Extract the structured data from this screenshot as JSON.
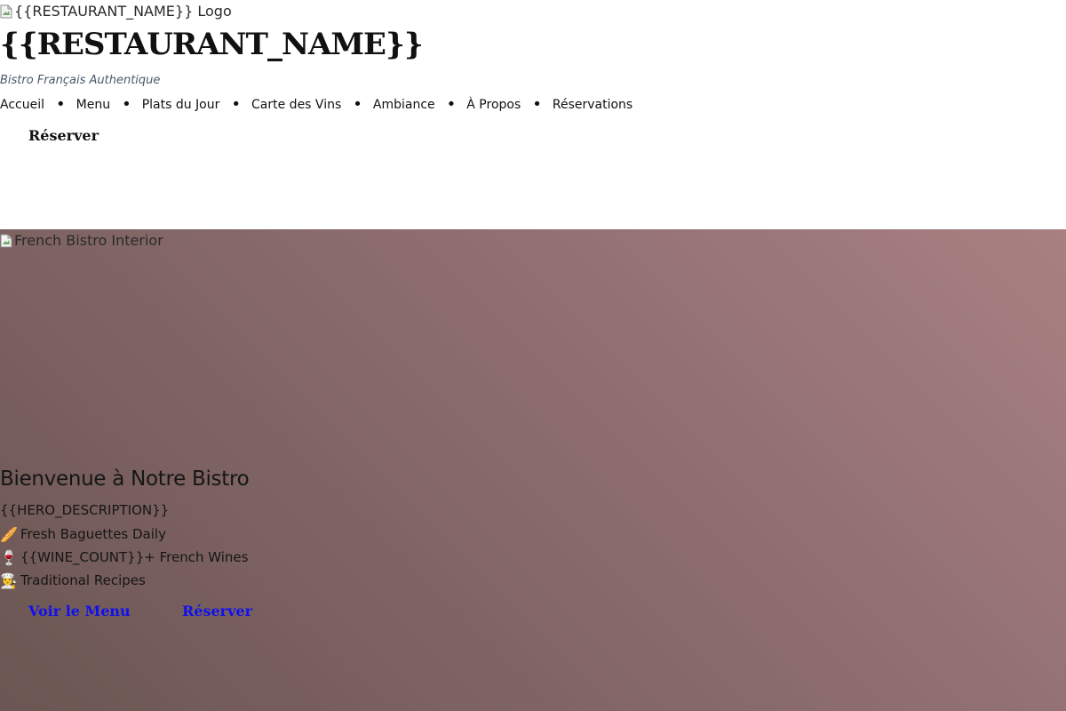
{
  "header": {
    "logo_alt": "{{RESTAURANT_NAME}} Logo",
    "site_title": "{{RESTAURANT_NAME}}",
    "tagline": "Bistro Français Authentique",
    "nav": [
      {
        "label": "Accueil"
      },
      {
        "label": "Menu"
      },
      {
        "label": "Plats du Jour"
      },
      {
        "label": "Carte des Vins"
      },
      {
        "label": "Ambiance"
      },
      {
        "label": "À Propos"
      },
      {
        "label": "Réservations"
      }
    ],
    "reserve_label": "Réserver"
  },
  "hero": {
    "image_alt": "French Bistro Interior",
    "title": "Bienvenue à Notre Bistro",
    "description": "{{HERO_DESCRIPTION}}",
    "features": [
      {
        "icon": "🥖",
        "icon_name": "baguette-icon",
        "text": "Fresh Baguettes Daily"
      },
      {
        "icon": "🍷",
        "icon_name": "wine-glass-icon",
        "text": "{{WINE_COUNT}}+ French Wines"
      },
      {
        "icon": "👨‍🍳",
        "icon_name": "chef-icon",
        "text": "Traditional Recipes"
      }
    ],
    "cta_menu_label": "Voir le Menu",
    "cta_reserve_label": "Réserver"
  },
  "colors": {
    "link": "#1010ee",
    "hero_gradient_start": "#a88082",
    "hero_gradient_end": "#6a5652",
    "tagline": "#4a5a6a"
  }
}
